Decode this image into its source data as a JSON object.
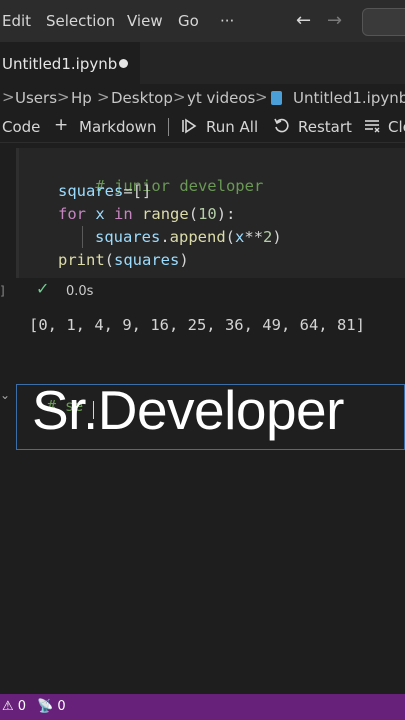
{
  "menu": {
    "items": [
      "Edit",
      "Selection",
      "View",
      "Go"
    ],
    "more": "···",
    "back_icon": "arrow-left-icon",
    "forward_icon": "arrow-right-icon"
  },
  "tab": {
    "label": "Untitled1.ipynb",
    "modified_indicator": "●"
  },
  "breadcrumb": {
    "items": [
      "Users",
      "Hp",
      "Desktop",
      "yt videos",
      "Untitled1.ipynb"
    ],
    "separator": ">"
  },
  "toolbar": {
    "code_label": "Code",
    "add_icon": "+",
    "markdown_label": "Markdown",
    "run_icon": "run-all-icon",
    "run_all_label": "Run All",
    "restart_icon": "restart-icon",
    "restart_label": "Restart",
    "clear_icon": "clear-outputs-icon",
    "clear_label": "Cle"
  },
  "cell1": {
    "lines": {
      "l1": "# junior developer",
      "l2_var": "squares",
      "l2_rest": "=[]",
      "l3_for": "for",
      "l3_x": "x",
      "l3_in": "in",
      "l3_range": "range",
      "l3_open": "(",
      "l3_num": "10",
      "l3_close": "):",
      "l4_obj": "squares",
      "l4_dot": ".",
      "l4_fn": "append",
      "l4_open": "(",
      "l4_x": "x",
      "l4_op": "**",
      "l4_num": "2",
      "l4_close": ")",
      "l5_fn": "print",
      "l5_open": "(",
      "l5_arg": "squares",
      "l5_close": ")"
    },
    "status": "✓",
    "exec_time": "0.0s",
    "gutter_mark": "]"
  },
  "output": {
    "text": "[0, 1, 4, 9, 16, 25, 36, 49, 64, 81]"
  },
  "cell2": {
    "chevron": "⌄",
    "code": "# se",
    "overlay_text": "Sr.Developer"
  },
  "statusbar": {
    "warnings": "⚠ 0",
    "ports": "📡 0"
  },
  "colors": {
    "accent": "#68217a",
    "cell_focus_border": "#3e6ea8",
    "success": "#73c991",
    "comment": "#6a9955",
    "variable": "#9cdcfe",
    "keyword": "#c586c0",
    "function": "#dcdcaa",
    "number": "#b5cea8"
  }
}
